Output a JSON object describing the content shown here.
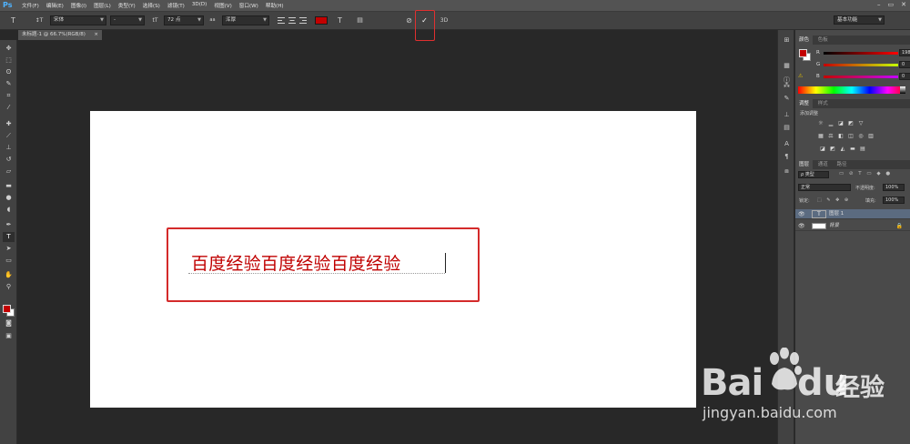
{
  "app": {
    "logo": "Ps",
    "menu": [
      "文件(F)",
      "编辑(E)",
      "图像(I)",
      "图层(L)",
      "类型(Y)",
      "选择(S)",
      "滤镜(T)",
      "3D(D)",
      "视图(V)",
      "窗口(W)",
      "帮助(H)"
    ],
    "window_controls": [
      "–",
      "▭",
      "✕"
    ]
  },
  "options": {
    "tool_glyph": "T",
    "orient_glyph": "↕T",
    "font_family": "宋体",
    "font_style": "-",
    "size_glyph": "tT",
    "font_size": "72 点",
    "aa_glyph": "aa",
    "antialias": "浑厚",
    "warp_glyph": "T",
    "panel_glyph": "▤",
    "cancel_glyph": "⊘",
    "commit_glyph": "✓",
    "threed_label": "3D",
    "workspace": "基本功能",
    "text_color": "#c30000"
  },
  "document": {
    "tab_title": "未标题-1 @ 66.7%(RGB/8)",
    "close_glyph": "×",
    "text": "百度经验百度经验百度经验"
  },
  "color_panel": {
    "tabs": [
      "颜色",
      "色板"
    ],
    "rows": [
      {
        "label": "R",
        "value": "198"
      },
      {
        "label": "G",
        "value": "0"
      },
      {
        "label": "B",
        "value": "0"
      }
    ],
    "warning_glyph": "⚠"
  },
  "adjust_panel": {
    "tabs": [
      "调整",
      "样式"
    ],
    "caption": "添加调整"
  },
  "layers_panel": {
    "tabs": [
      "图层",
      "通道",
      "路径"
    ],
    "filter": "ρ 类型",
    "blend_mode": "正常",
    "opacity_label": "不透明度:",
    "opacity": "100%",
    "lock_label": "锁定:",
    "fill_label": "填充:",
    "fill": "100%",
    "layers": [
      {
        "name": "图层 1",
        "thumb": "T",
        "selected": true
      },
      {
        "name": "背景",
        "thumb": "",
        "selected": false
      }
    ]
  },
  "watermark": {
    "bai": "Bai",
    "du": "du",
    "cn": "经验",
    "url": "jingyan.baidu.com"
  }
}
